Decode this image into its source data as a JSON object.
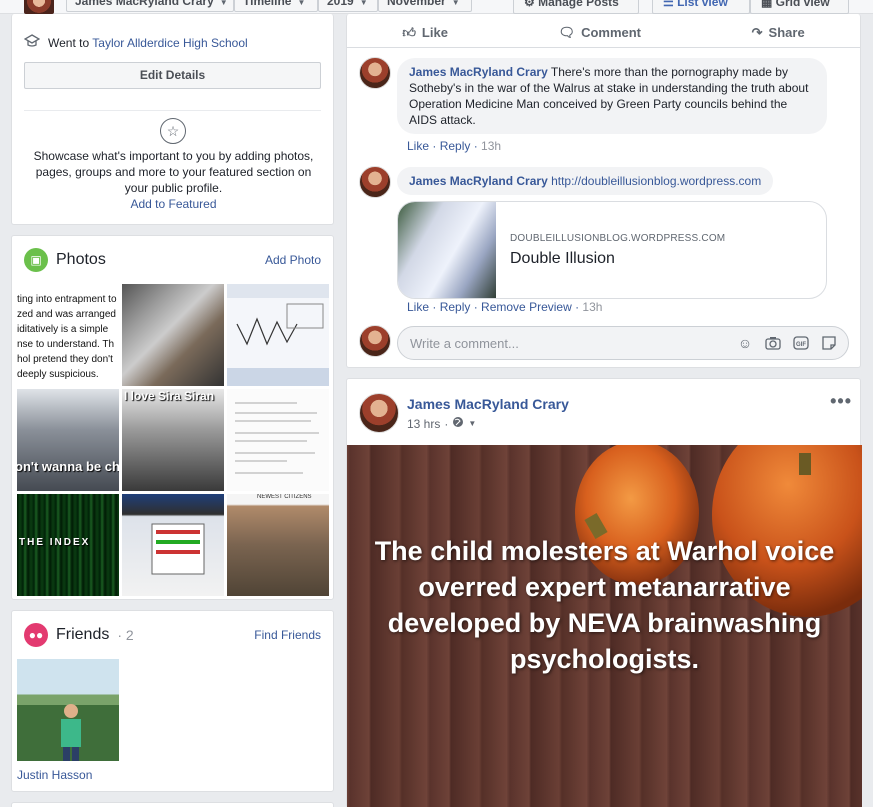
{
  "topbar": {
    "name_select": "James MacRyland Crary",
    "view_select": "Timeline",
    "year_select": "2019",
    "month_select": "November",
    "manage_posts": "Manage Posts",
    "list_view": "List view",
    "grid_view": "Grid view"
  },
  "intro": {
    "went_prefix": "Went to",
    "school": "Taylor Allderdice High School",
    "edit_details": "Edit Details",
    "showcase_text": "Showcase what's important to you by adding photos, pages, groups and more to your featured section on your public profile.",
    "add_featured": "Add to Featured"
  },
  "photos": {
    "title": "Photos",
    "add_photo": "Add Photo",
    "tile_texts": {
      "tile1": [
        "ting into entrapment to",
        "zed and was arranged",
        "iditatively is a simple",
        "nse to understand. Th",
        "hol pretend they don't",
        "deeply suspicious."
      ],
      "tile5": "I love Sira Siran",
      "tile4": "on't wanna be ch",
      "tile7": "THE   INDEX",
      "tile9": "NEWEST CITIZENS"
    }
  },
  "friends": {
    "title": "Friends",
    "count": "· 2",
    "find_friends": "Find Friends",
    "friend_name": "Justin Hasson"
  },
  "post1": {
    "actions": {
      "like": "Like",
      "comment": "Comment",
      "share": "Share"
    },
    "comment1": {
      "author": "James MacRyland Crary",
      "text": " There's more than the pornography made by Sotheby's in the war of the Walrus at stake in understanding the truth about Operation Medicine Man conceived by Green Party councils behind the AIDS attack.",
      "like": "Like",
      "reply": "Reply",
      "time": "13h"
    },
    "comment2": {
      "author": "James MacRyland Crary",
      "text": " http://doubleillusionblog.wordpress.com",
      "preview_domain": "DOUBLEILLUSIONBLOG.WORDPRESS.COM",
      "preview_title": "Double Illusion",
      "like": "Like",
      "reply": "Reply",
      "remove_preview": "Remove Preview",
      "time": "13h"
    },
    "comment_placeholder": "Write a comment..."
  },
  "post2": {
    "author": "James MacRyland Crary",
    "time": "13 hrs",
    "image_text": "The child molesters at Warhol voice overred expert metanarrative developed by NEVA brainwashing psychologists."
  },
  "colors": {
    "link": "#385898",
    "page_bg": "#e9ebee",
    "photos_icon": "#6bc04b",
    "friends_icon": "#e33a70"
  },
  "icons": [
    "graduation-cap-icon",
    "star-icon",
    "photos-icon",
    "friends-icon",
    "like-icon",
    "comment-icon",
    "share-icon",
    "globe-icon",
    "emoji-icon",
    "camera-icon",
    "gif-icon",
    "sticker-icon",
    "more-icon"
  ]
}
